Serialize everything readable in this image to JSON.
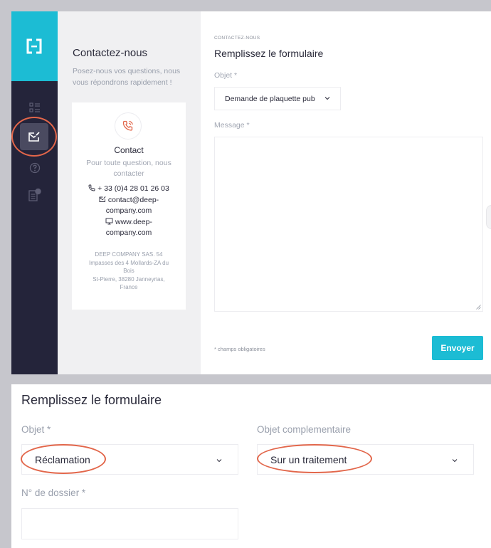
{
  "colors": {
    "sidebar_bg": "#24243a",
    "brand_accent": "#1cbcd4",
    "annotation": "#e2664a",
    "contact_icon": "#e2664a"
  },
  "sidebar": {
    "logo_icon": "brackets-logo-icon",
    "nav": [
      {
        "icon": "list-icon",
        "active": false
      },
      {
        "icon": "mail-edit-icon",
        "active": true
      },
      {
        "icon": "help-circle-icon",
        "active": false
      },
      {
        "icon": "document-badge-icon",
        "active": false
      }
    ]
  },
  "contact_panel": {
    "title": "Contactez-nous",
    "subtitle": "Posez-nous vos questions, nous vous répondrons rapidement !",
    "card": {
      "icon": "phone-ring-icon",
      "title": "Contact",
      "subtitle": "Pour toute question, nous contacter",
      "phone": "+ 33 (0)4 28 01 26 03",
      "email_line1": "contact@deep-",
      "email_line2": "company.com",
      "web_line1": "www.deep-",
      "web_line2": "company.com",
      "address_line1": "DEEP COMPANY SAS. 54",
      "address_line2": "Impasses des 4 Mollards-ZA du",
      "address_line3": "Bois",
      "address_line4": "St-Pierre, 38280 Janneyrias,",
      "address_line5": "France"
    }
  },
  "form": {
    "eyebrow": "CONTACTEZ-NOUS",
    "title": "Remplissez le formulaire",
    "objet_label": "Objet *",
    "objet_value": "Demande de plaquette pub",
    "message_label": "Message *",
    "message_value": "",
    "required_note": "* champs obligatoires",
    "submit_label": "Envoyer"
  },
  "form_detail": {
    "title": "Remplissez le formulaire",
    "objet_label": "Objet *",
    "objet_value": "Réclamation",
    "objet_comp_label": "Objet complementaire",
    "objet_comp_value": "Sur un traitement",
    "dossier_label": "N° de dossier *",
    "dossier_value": ""
  }
}
